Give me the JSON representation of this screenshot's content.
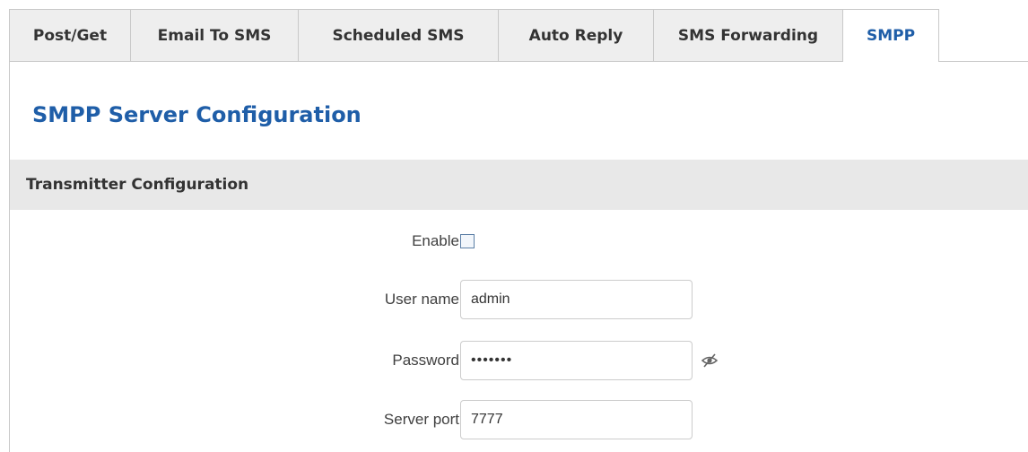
{
  "tabs": [
    {
      "label": "Post/Get",
      "active": false
    },
    {
      "label": "Email To SMS",
      "active": false
    },
    {
      "label": "Scheduled SMS",
      "active": false
    },
    {
      "label": "Auto Reply",
      "active": false
    },
    {
      "label": "SMS Forwarding",
      "active": false
    },
    {
      "label": "SMPP",
      "active": true
    }
  ],
  "page_title": "SMPP Server Configuration",
  "section": {
    "title": "Transmitter Configuration"
  },
  "form": {
    "enable": {
      "label": "Enable",
      "checked": false
    },
    "username": {
      "label": "User name",
      "value": "admin"
    },
    "password": {
      "label": "Password",
      "value": "•••••••",
      "icon": "eye-slash-icon"
    },
    "server_port": {
      "label": "Server port",
      "value": "7777"
    }
  },
  "colors": {
    "accent": "#1f5ea8",
    "tab_bg": "#eeeeee",
    "section_bg": "#e8e8e8",
    "border": "#c9c9c9"
  }
}
